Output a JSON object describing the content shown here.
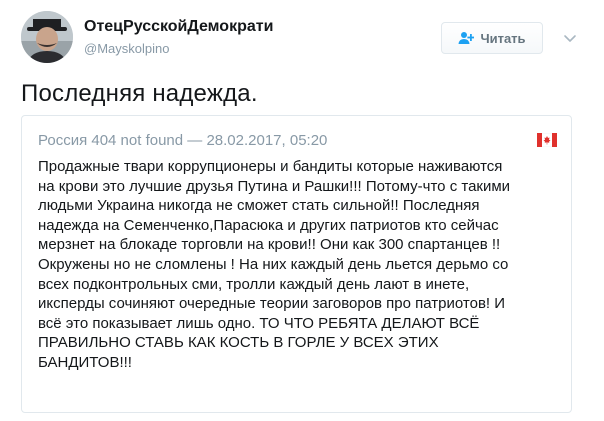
{
  "author": {
    "name": "ОтецРусскойДемократи",
    "handle": "@Mayskolpino",
    "avatar_icon": "avatar-portrait"
  },
  "follow": {
    "label": "Читать",
    "icon": "add-user-icon"
  },
  "menu": {
    "icon": "chevron-down-icon"
  },
  "tweet": {
    "text": "Последняя надежда."
  },
  "quoted": {
    "author": "Россия 404 not found",
    "separator": "—",
    "timestamp": "28.02.2017, 05:20",
    "flag_icon": "canada-flag-icon",
    "lines": [
      "Продажные твари коррупционеры и бандиты которые наживаются",
      "на крови это лучшие друзья Путина и Рашки!!! Потому-что с такими",
      "людьми Украина никогда не сможет стать сильной!! Последняя",
      "надежда на Семенченко,Парасюка и других патриотов кто сейчас",
      "мерзнет на блокаде торговли на крови!! Они как 300 спартанцев !!",
      "Окружены но не сломлены ! На них каждый день льется дерьмо со",
      "всех подконтрольных сми, тролли каждый день лают в инете,",
      "иксперды сочиняют очередные теории заговоров про патриотов! И",
      "всё это показывает лишь одно. ТО ЧТО РЕБЯТА ДЕЛАЮТ ВСЁ",
      "ПРАВИЛЬНО СТАВЬ КАК КОСТЬ В ГОРЛЕ У ВСЕХ ЭТИХ",
      "БАНДИТОВ!!!"
    ]
  },
  "colors": {
    "primary_text": "#14171a",
    "secondary_text": "#8899a6",
    "border": "#e1e8ed",
    "button_text": "#66757f",
    "follow_icon": "#1da1f2",
    "flag_red": "#e0312d"
  }
}
